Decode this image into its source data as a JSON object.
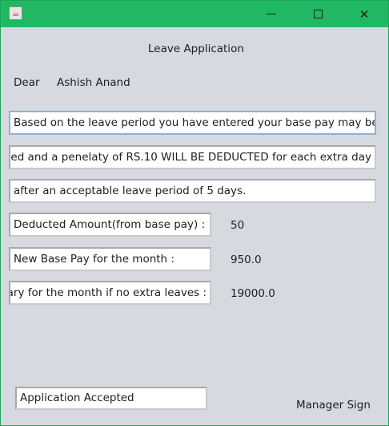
{
  "titlebar": {
    "app_icon": "java-cup-icon",
    "minimize_icon": "minimize-icon",
    "maximize_icon": "maximize-icon",
    "close_icon": "close-icon",
    "close_glyph": "✕"
  },
  "form": {
    "heading": "Leave Application",
    "greeting": "Dear",
    "employee_name": "Ashish Anand",
    "message_line1": "Based on the leave period you have entered your base pay may be",
    "message_line2": "ed and a penelaty of RS.10 WILL BE DEDUCTED for each extra day",
    "message_line3": "after an acceptable leave period of 5 days.",
    "deducted_label": "Deducted Amount(from base pay) :",
    "deducted_value": "50",
    "new_base_label": "New Base Pay for the month :",
    "new_base_value": "950.0",
    "salary_label": "alary for the month if no extra leaves :",
    "salary_value": "19000.0",
    "status": "Application Accepted",
    "manager_sign": "Manager Sign"
  }
}
